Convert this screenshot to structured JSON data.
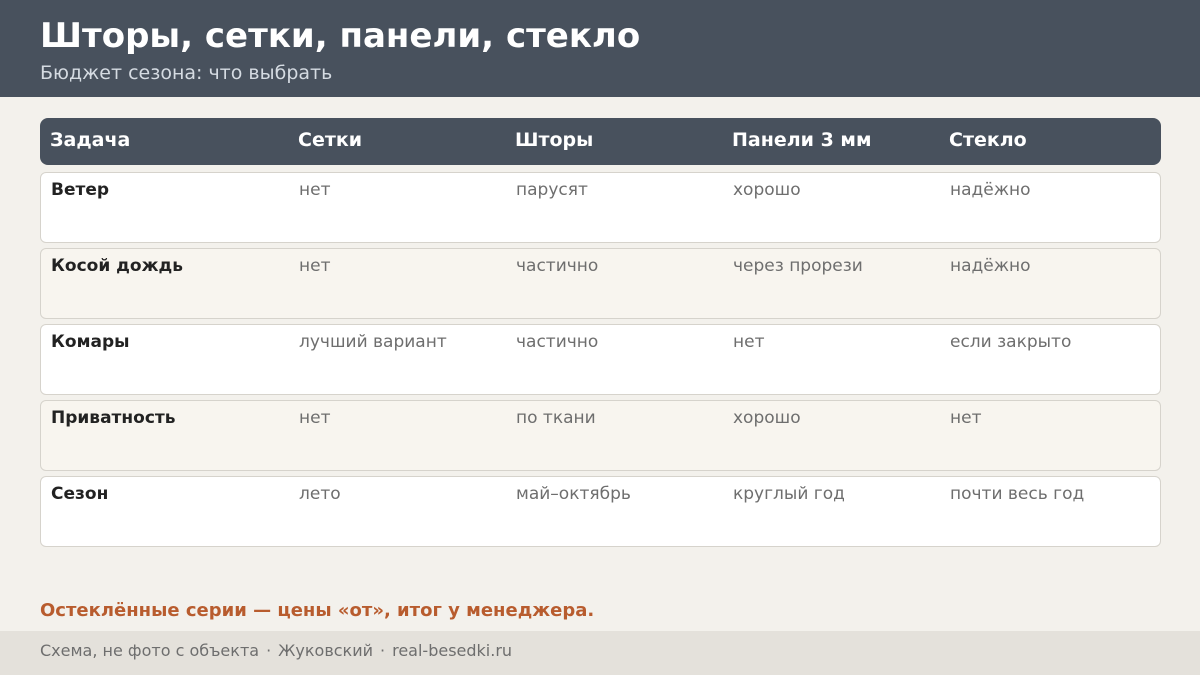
{
  "header": {
    "title": "Шторы, сетки, панели, стекло",
    "subtitle": "Бюджет сезона: что выбрать"
  },
  "table": {
    "columns": [
      "Задача",
      "Сетки",
      "Шторы",
      "Панели 3 мм",
      "Стекло"
    ],
    "rows": [
      [
        "Ветер",
        "нет",
        "парусят",
        "хорошо",
        "надёжно"
      ],
      [
        "Косой дождь",
        "нет",
        "частично",
        "через прорези",
        "надёжно"
      ],
      [
        "Комары",
        "лучший вариант",
        "частично",
        "нет",
        "если закрыто"
      ],
      [
        "Приватность",
        "нет",
        "по ткани",
        "хорошо",
        "нет"
      ],
      [
        "Сезон",
        "лето",
        "май–октябрь",
        "круглый год",
        "почти весь год"
      ]
    ]
  },
  "note": "Остеклённые серии — цены «от», итог у менеджера.",
  "footer": {
    "caption": "Схема, не фото с объекта",
    "separator": "·",
    "city": "Жуковский",
    "site": "real-besedki.ru"
  },
  "colors": {
    "header_bg": "#48515d",
    "page_bg": "#f3f1ec",
    "accent": "#b85c2e",
    "footer_bg": "#e4e1db"
  }
}
